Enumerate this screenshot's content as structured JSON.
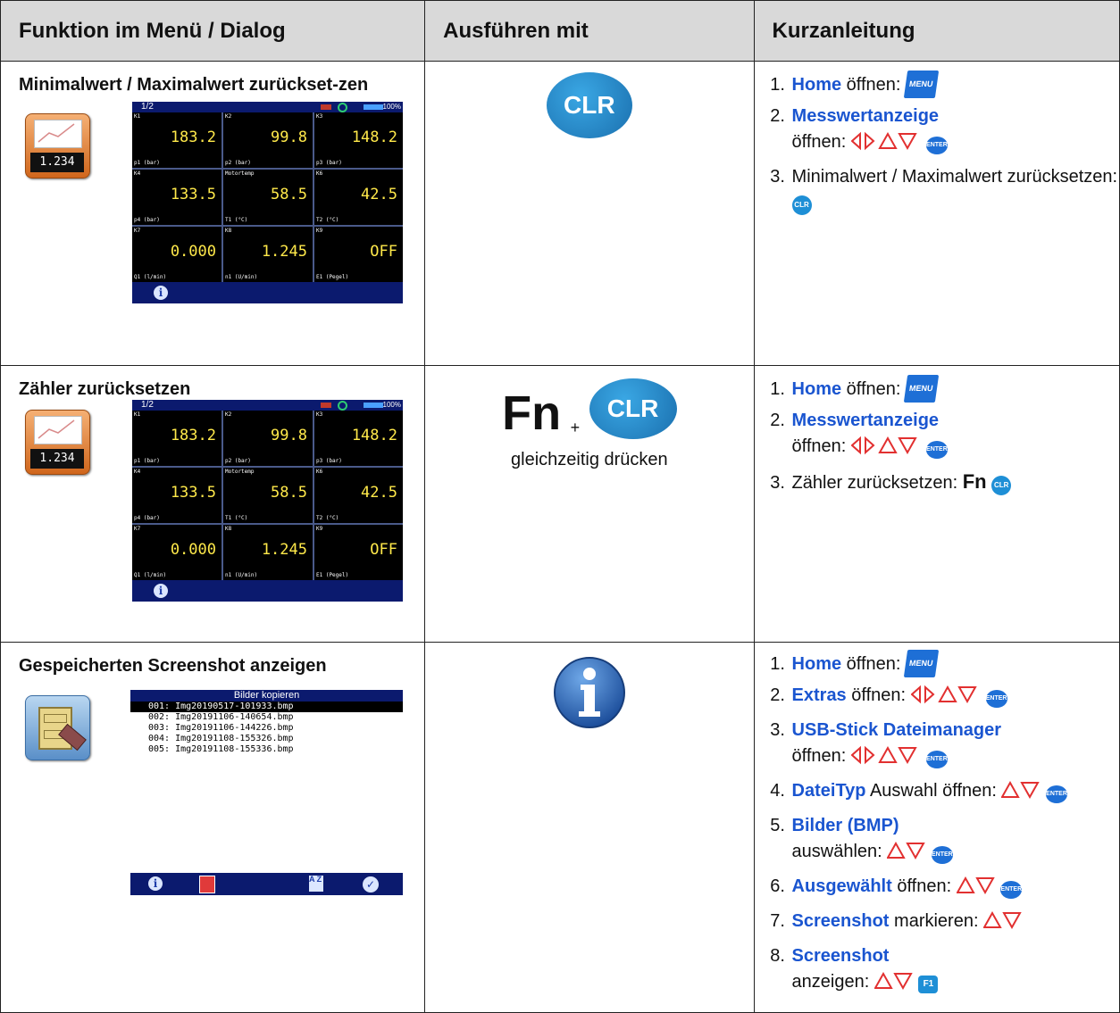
{
  "header": {
    "col1": "Funktion im Menü / Dialog",
    "col2": "Ausführen mit",
    "col3": "Kurzanleitung"
  },
  "device": {
    "page": "1/2",
    "battery_pct": "100%",
    "tile_value": "1.234",
    "cells": [
      {
        "k": "K1",
        "v": "183.2",
        "u": "p1 (bar)"
      },
      {
        "k": "K2",
        "v": "99.8",
        "u": "p2 (bar)"
      },
      {
        "k": "K3",
        "v": "148.2",
        "u": "p3 (bar)"
      },
      {
        "k": "K4",
        "v": "133.5",
        "u": "p4 (bar)"
      },
      {
        "k": "Motortemp",
        "v": "58.5",
        "u": "T1 (°C)"
      },
      {
        "k": "K6",
        "v": "42.5",
        "u": "T2 (°C)"
      },
      {
        "k": "K7",
        "v": "0.000",
        "u": "Q1 (l/min)"
      },
      {
        "k": "K8",
        "v": "1.245",
        "u": "n1 (U/min)"
      },
      {
        "k": "K9",
        "v": "OFF",
        "u": "E1 (Pegel)"
      }
    ]
  },
  "rows": [
    {
      "title": "Minimalwert / Maximalwert zurückset-zen",
      "key_label": "CLR",
      "steps": [
        {
          "link": "Home",
          "text": "öffnen:"
        },
        {
          "link": "Messwertanzeige",
          "text": "öffnen:"
        },
        {
          "link": "",
          "text": "Minimalwert / Maximalwert zurücksetzen:"
        }
      ]
    },
    {
      "title": "Zähler zurücksetzen",
      "key_fn": "Fn",
      "key_plus": "+",
      "key_label": "CLR",
      "key_note": "gleichzeitig drücken",
      "steps": [
        {
          "link": "Home",
          "text": "öffnen:"
        },
        {
          "link": "Messwertanzeige",
          "text": "öffnen:"
        },
        {
          "link": "",
          "text": "Zähler zurücksetzen:"
        }
      ]
    },
    {
      "title": "Gespeicherten Screenshot anzeigen",
      "key_label": "i",
      "files_title": "Bilder kopieren",
      "files": [
        "001: Img20190517-101933.bmp",
        "002: Img20191106-140654.bmp",
        "003: Img20191106-144226.bmp",
        "004: Img20191108-155326.bmp",
        "005: Img20191108-155336.bmp"
      ],
      "steps": [
        {
          "link": "Home",
          "text": "öffnen:"
        },
        {
          "link": "Extras",
          "text": "öffnen:"
        },
        {
          "link": "USB-Stick Dateimanager",
          "text": "öffnen:"
        },
        {
          "link": "DateiTyp",
          "text": "Auswahl öffnen:"
        },
        {
          "link": "Bilder (BMP)",
          "text": "auswählen:"
        },
        {
          "link": "Ausgewählt",
          "text": "öffnen:"
        },
        {
          "link": "Screenshot",
          "text": "markieren:"
        },
        {
          "link": "Screenshot",
          "text": "anzeigen:"
        }
      ]
    }
  ],
  "keys": {
    "menu": "MENU",
    "enter": "ENTER",
    "clr": "CLR",
    "fn": "Fn",
    "f1": "F1"
  },
  "colors": {
    "link": "#1a55d0",
    "key_blue": "#1e6fd6",
    "header_bg": "#d9d9d9",
    "screen_bar": "#0b1a6e",
    "value_yellow": "#ffe94a"
  }
}
